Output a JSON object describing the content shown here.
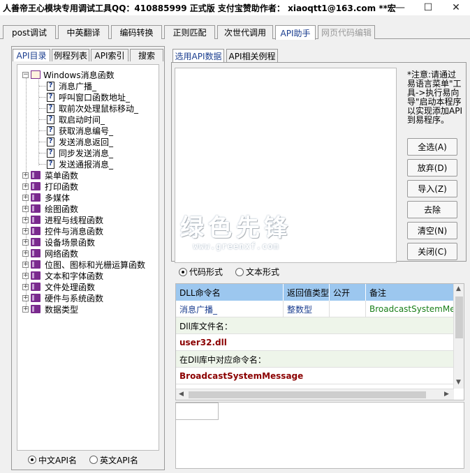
{
  "window": {
    "title": "人善帝王心模块专用调试工具QQ：410885999 正式版    支付宝赞助作者： xiaoqtt1@163.com **宏",
    "minimize_icon": "minimize-icon",
    "maximize_icon": "maximize-icon",
    "close_icon": "close-icon"
  },
  "top_tabs": [
    "post调试",
    "中英翻译",
    "编码转换",
    "正则匹配",
    "次世代调用",
    "API助手",
    "网页代码编辑"
  ],
  "left_tabs": [
    "API目录",
    "例程列表",
    "API索引",
    "搜索"
  ],
  "tree": {
    "root": "Windows消息函数",
    "root_children": [
      "消息广播_",
      "呼叫窗口函数地址_",
      "取前次处理鼠标移动_",
      "取启动时间_",
      "获取消息编号_",
      "发送消息返回_",
      "同步发送消息_",
      "发送通报消息_"
    ],
    "categories": [
      "菜单函数",
      "打印函数",
      "多媒体",
      "绘图函数",
      "进程与线程函数",
      "控件与消息函数",
      "设备场景函数",
      "网络函数",
      "位图、图标和光栅运算函数",
      "文本和字体函数",
      "文件处理函数",
      "硬件与系统函数",
      "数据类型"
    ]
  },
  "left_radios": [
    "中文API名",
    "英文API名"
  ],
  "right_tabs": [
    "选用API数据",
    "API相关例程"
  ],
  "note": "*注意:请通过易语言菜单\"工具->执行易向导\"启动本程序以实现添加API到易程序。",
  "side_buttons": [
    "全选(A)",
    "放弃(D)",
    "导入(Z)",
    "去除",
    "清空(N)",
    "关闭(C)"
  ],
  "mid_radios": [
    "代码形式",
    "文本形式"
  ],
  "grid": {
    "headers": [
      "DLL命令名",
      "返回值类型",
      "公开",
      "备注"
    ],
    "row": [
      "消息广播_",
      "整数型",
      "",
      "BroadcastSystemMessage"
    ],
    "dll_label": "Dll库文件名：",
    "dll_value": "user32.dll",
    "cmd_label": "在Dll库中对应命令名：",
    "cmd_value": "BroadcastSystemMessage"
  },
  "watermark": {
    "cn": "绿色先锋",
    "url": "www.greenxf.com"
  },
  "colors": {
    "header_blue": "#9cc7ef",
    "active_tab_text": "#1a3d8f",
    "value_red": "#8b0000",
    "remark_green": "#1a7f1a",
    "book_purple": "#7a2a8e"
  }
}
